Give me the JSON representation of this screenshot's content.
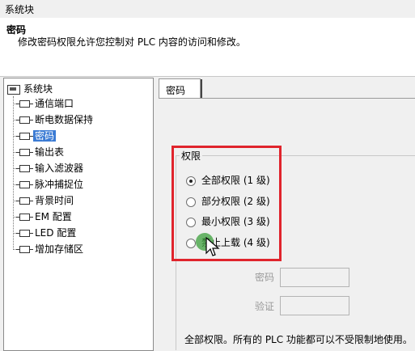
{
  "window": {
    "title": "系统块"
  },
  "header": {
    "title": "密码",
    "description": "修改密码权限允许您控制对 PLC 内容的访问和修改。"
  },
  "tree": {
    "root": "系统块",
    "items": [
      {
        "label": "通信端口",
        "selected": false
      },
      {
        "label": "断电数据保持",
        "selected": false
      },
      {
        "label": "密码",
        "selected": true
      },
      {
        "label": "输出表",
        "selected": false
      },
      {
        "label": "输入滤波器",
        "selected": false
      },
      {
        "label": "脉冲捕捉位",
        "selected": false
      },
      {
        "label": "背景时间",
        "selected": false
      },
      {
        "label": "EM 配置",
        "selected": false
      },
      {
        "label": "LED 配置",
        "selected": false
      },
      {
        "label": "增加存储区",
        "selected": false
      }
    ]
  },
  "tab": {
    "label": "密码"
  },
  "permissions": {
    "group_title": "权限",
    "options": [
      {
        "label": "全部权限 (1 级)",
        "checked": true
      },
      {
        "label": "部分权限 (2 级)",
        "checked": false
      },
      {
        "label": "最小权限 (3 级)",
        "checked": false
      },
      {
        "label": "禁止上载 (4 级)",
        "checked": false
      }
    ],
    "highlight_color": "#e0242c"
  },
  "fields": {
    "password_label": "密码",
    "verify_label": "验证"
  },
  "info_text": "全部权限。所有的 PLC 功能都可以不受限制地使用。",
  "colors": {
    "selection": "#3b7bd4",
    "cursor_marker": "#3ca03c"
  }
}
